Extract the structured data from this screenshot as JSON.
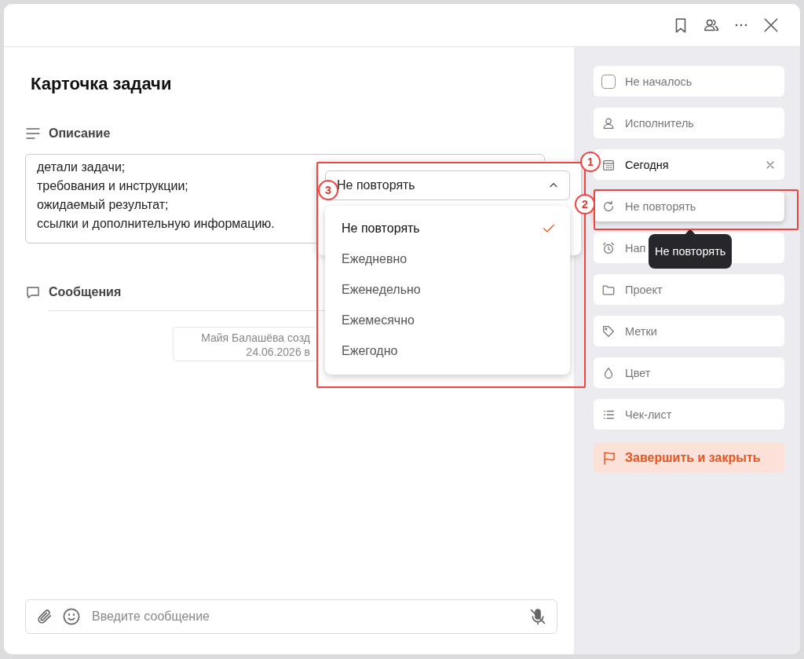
{
  "title": "Карточка задачи",
  "description": {
    "label": "Описание",
    "lines": [
      "детали задачи;",
      "требования и инструкции;",
      "ожидаемый результат;",
      "ссылки и дополнительную информацию."
    ]
  },
  "messages": {
    "label": "Сообщения",
    "system_message": [
      "Майя Балашёва созд",
      "24.06.2026 в"
    ]
  },
  "composer": {
    "placeholder": "Введите сообщение"
  },
  "sidebar": {
    "items": [
      {
        "kind": "status",
        "label": "Не началось",
        "set": false,
        "highlighted": false,
        "checked": false
      },
      {
        "kind": "assignee",
        "label": "Исполнитель",
        "set": false,
        "highlighted": false
      },
      {
        "kind": "date",
        "label": "Сегодня",
        "set": true,
        "highlighted": false
      },
      {
        "kind": "repeat",
        "label": "Не повторять",
        "set": false,
        "highlighted": true
      },
      {
        "kind": "reminder",
        "label": "Нап",
        "set": false,
        "highlighted": false
      },
      {
        "kind": "project",
        "label": "Проект",
        "set": false,
        "highlighted": false
      },
      {
        "kind": "tags",
        "label": "Метки",
        "set": false,
        "highlighted": false
      },
      {
        "kind": "color",
        "label": "Цвет",
        "set": false,
        "highlighted": false
      },
      {
        "kind": "checklist",
        "label": "Чек-лист",
        "set": false,
        "highlighted": false
      }
    ],
    "finish_button": "Завершить и закрыть"
  },
  "tooltip": {
    "text": "Не повторять"
  },
  "repeat_popup": {
    "value": "Не повторять",
    "expanded": true,
    "options": [
      {
        "label": "Не повторять",
        "selected": true
      },
      {
        "label": "Ежедневно",
        "selected": false
      },
      {
        "label": "Еженедельно",
        "selected": false
      },
      {
        "label": "Ежемесячно",
        "selected": false
      },
      {
        "label": "Ежегодно",
        "selected": false
      }
    ]
  },
  "annotations": [
    {
      "number": "1"
    },
    {
      "number": "2"
    },
    {
      "number": "3"
    }
  ]
}
